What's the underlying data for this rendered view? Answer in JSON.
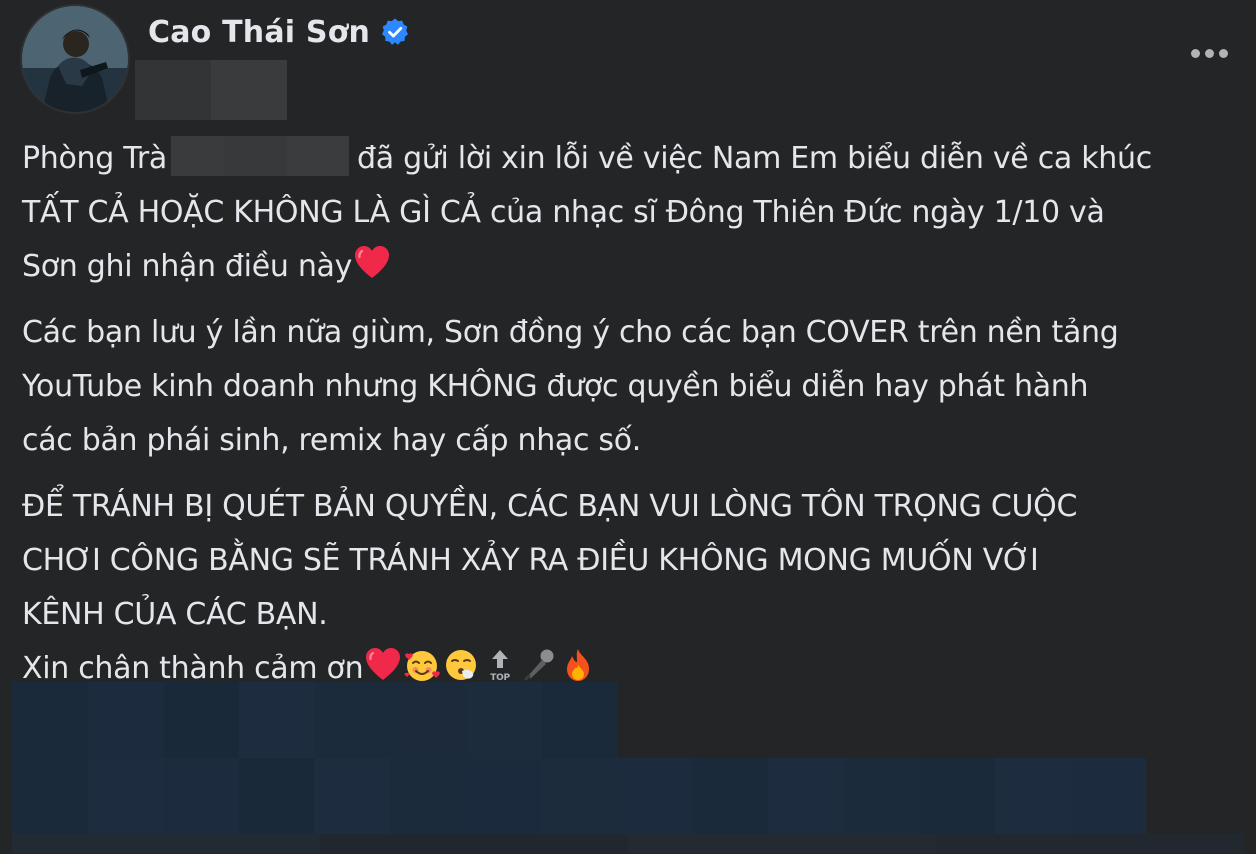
{
  "post": {
    "author_name": "Cao Thái Sơn",
    "author_verified": true,
    "more_options_icon": "more-horizontal-icon",
    "paragraphs": [
      {
        "lines": [
          {
            "before": "Phòng Trà",
            "redacted": true,
            "after": "đã gửi lời xin lỗi về việc Nam Em biểu diễn về ca khúc"
          },
          {
            "text": "TẤT CẢ HOẶC KHÔNG LÀ GÌ CẢ của nhạc sĩ Đông Thiên Đức ngày 1/10 và"
          },
          {
            "text": "Sơn ghi nhận điều này",
            "emojis": [
              "red-heart"
            ]
          }
        ]
      },
      {
        "lines": [
          {
            "text": "Các bạn lưu ý lần nữa giùm, Sơn đồng ý cho các bạn COVER trên nền tảng"
          },
          {
            "text": "YouTube kinh doanh nhưng KHÔNG được quyền biểu diễn hay phát hành"
          },
          {
            "text": "các bản phái sinh, remix hay cấp nhạc số."
          }
        ]
      },
      {
        "lines": [
          {
            "text": "ĐỂ TRÁNH BỊ QUÉT BẢN QUYỀN, CÁC BẠN VUI LÒNG TÔN TRỌNG CUỘC"
          },
          {
            "text": "CHƠI CÔNG BẰNG SẼ TRÁNH XẢY RA ĐIỀU KHÔNG MONG MUỐN VỚI"
          },
          {
            "text": "KÊNH CỦA CÁC BẠN."
          },
          {
            "text": "Xin chân thành cảm ơn",
            "emojis": [
              "red-heart",
              "smiling-face-with-hearts",
              "face-exhaling",
              "top-arrow",
              "microphone",
              "fire"
            ]
          }
        ]
      }
    ]
  },
  "colors": {
    "background": "#242526",
    "text": "#e4e6eb",
    "verified_badge": "#2d88ff",
    "heart": "#f02849",
    "redacted_attachment": "#1c2b3d"
  }
}
